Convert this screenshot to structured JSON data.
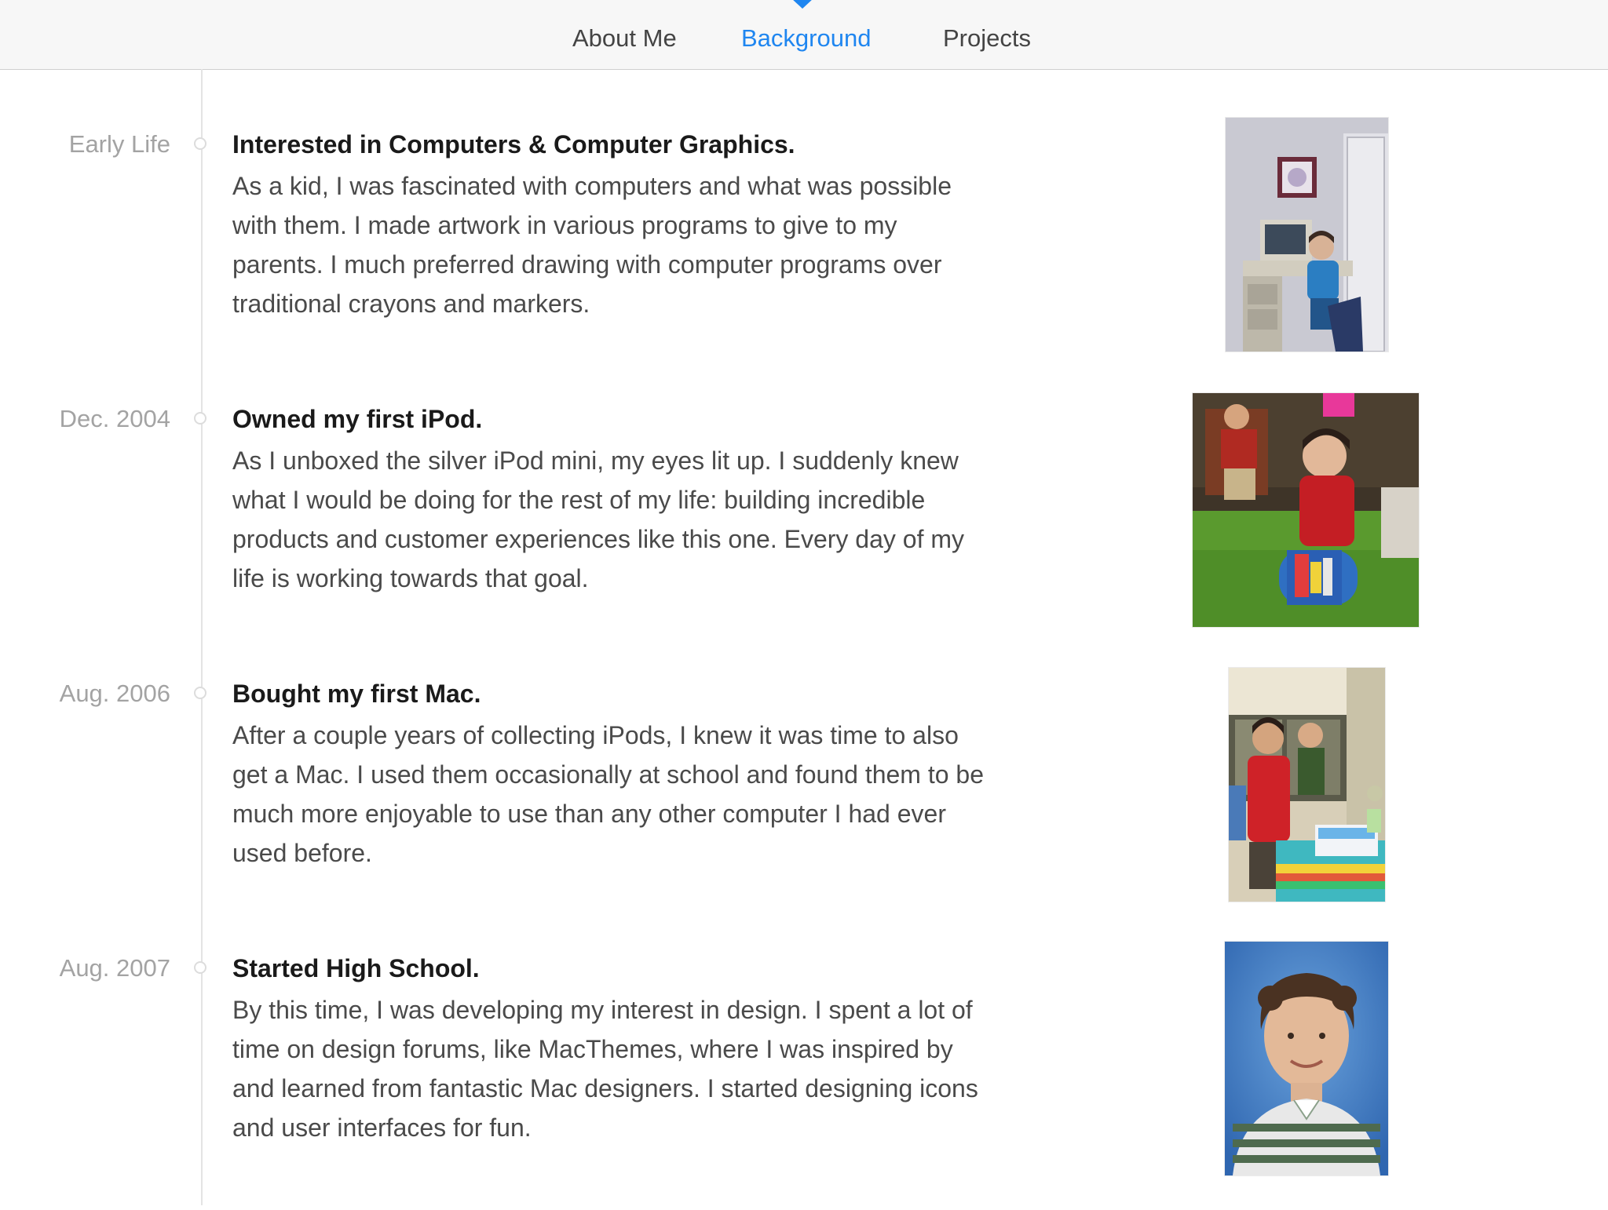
{
  "nav": {
    "tabs": [
      {
        "label": "About Me",
        "active": false
      },
      {
        "label": "Background",
        "active": true
      },
      {
        "label": "Projects",
        "active": false
      }
    ],
    "active_color": "#1f86f0"
  },
  "timeline": {
    "entries": [
      {
        "date": "Early Life",
        "title": "Interested in Computers & Computer Graphics.",
        "body": "As a kid, I was fascinated with computers and what was possible with them. I made artwork in various programs to give to my parents. I much preferred drawing with computer programs over traditional crayons and markers.",
        "photo": "child-at-computer-photo"
      },
      {
        "date": "Dec. 2004",
        "title": "Owned my first iPod.",
        "body": "As I unboxed the silver iPod mini, my eyes lit up. I suddenly knew what I would be doing for the rest of my life: building incredible products and customer experiences like this one. Every day of my life is working towards that goal.",
        "photo": "unwrapping-gift-photo"
      },
      {
        "date": "Aug. 2006",
        "title": "Bought my first Mac.",
        "body": "After a couple years of collecting iPods, I knew it was time to also get a Mac. I used them occasionally at school and found them to be much more enjoyable to use than any other computer I had ever used before.",
        "photo": "birthday-cake-photo"
      },
      {
        "date": "Aug. 2007",
        "title": "Started High School.",
        "body": "By this time, I was developing my interest in design. I spent a lot of time on design forums, like MacThemes, where I was inspired by and learned from fantastic Mac designers. I started designing icons and user interfaces for fun.",
        "photo": "school-portrait-photo"
      }
    ]
  }
}
